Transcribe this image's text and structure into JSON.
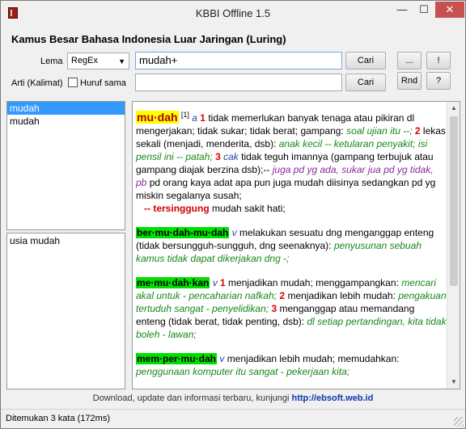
{
  "window": {
    "title": "KBBI Offline 1.5",
    "min_glyph": "—",
    "max_glyph": "☐",
    "close_glyph": "✕"
  },
  "heading": "Kamus Besar Bahasa Indonesia Luar Jaringan (Luring)",
  "search": {
    "lema_label": "Lema",
    "mode_value": "RegEx",
    "query_value": "mudah+",
    "arti_label": "Arti (Kalimat)",
    "exact_label": "Huruf sama",
    "arti_value": "",
    "cari_label": "Cari",
    "cari2_label": "Cari",
    "more_label": "...",
    "bang_label": "!",
    "rnd_label": "Rnd",
    "help_label": "?"
  },
  "results": {
    "items": [
      "mudah",
      "mudah"
    ],
    "idioms": [
      "usia mudah"
    ]
  },
  "article": {
    "p1": {
      "hw": "mu·dah",
      "sup": "[1]",
      "pos": "a",
      "n1": "1",
      "t1": " tidak memerlukan banyak tenaga atau pikiran dl mengerjakan; tidak sukar; tidak berat; gampang: ",
      "e1": "soal ujian itu --;",
      "n2": "2",
      "t2": " lekas sekali (menjadi, menderita, dsb): ",
      "e2": "anak kecil -- ketularan penyakit; isi pensil ini -- patah;",
      "n3": "3",
      "pos3": "cak",
      "t3": " tidak teguh imannya (gampang terbujuk atau gampang diajak berzina dsb);-- ",
      "e3": "juga pd yg ada, sukar jua pd yg tidak,",
      "e3b": "pb",
      "t4": " pd orang kaya adat apa pun juga mudah diisinya sedangkan pd yg miskin segalanya susah;",
      "sub": "-- tersinggung",
      "t5": " mudah sakit hati;"
    },
    "p2": {
      "hw": "ber·mu·dah-mu·dah",
      "pos": "v",
      "t1": " melakukan sesuatu dng menganggap enteng (tidak bersungguh-sungguh, dng seenaknya): ",
      "e1": "penyusunan sebuah kamus tidak dapat dikerjakan dng -;"
    },
    "p3": {
      "hw": "me·mu·dah·kan",
      "pos": "v",
      "n1": "1",
      "t1": " menjadikan mudah; menggampangkan: ",
      "e1": "mencari akal untuk - pencaharian nafkah;",
      "n2": "2",
      "t2": " menjadikan lebih mudah: ",
      "e2": "pengakuan tertuduh sangat - penyelidikan;",
      "n3": "3",
      "t3": " menganggap atau memandang enteng (tidak berat, tidak penting, dsb): ",
      "e3": "dl setiap pertandingan, kita tidak boleh - lawan;"
    },
    "p4": {
      "hw": "mem·per·mu·dah",
      "pos": "v",
      "t1": " menjadikan lebih mudah; memudahkan: ",
      "e1": "penggunaan komputer itu sangat - pekerjaan kita;"
    }
  },
  "footer": {
    "text": "Download, update dan informasi terbaru, kunjungi ",
    "link": "http://ebsoft.web.id"
  },
  "status": "Ditemukan 3 kata (172ms)"
}
